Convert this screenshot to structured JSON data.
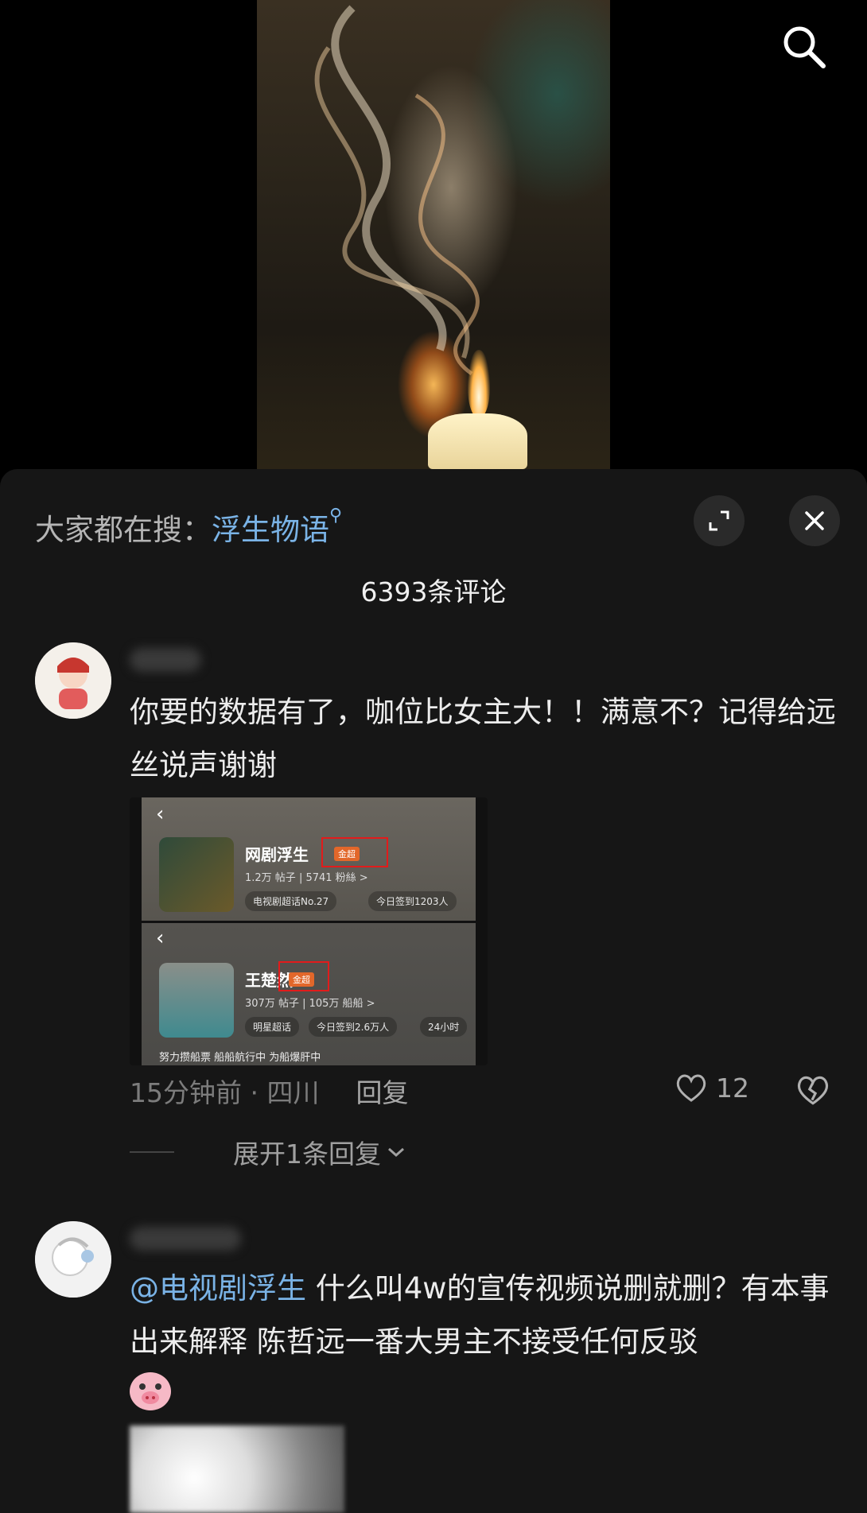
{
  "search_hint": {
    "prefix": "大家都在搜：",
    "keyword": "浮生物语"
  },
  "comment_count": "6393条评论",
  "comments": [
    {
      "text": "你要的数据有了，咖位比女主大！！满意不？记得给远丝说声谢谢",
      "time_location": "15分钟前 · 四川",
      "reply_label": "回复",
      "likes": "12",
      "expand_label": "展开1条回复",
      "image": {
        "panel1": {
          "title": "网剧浮生",
          "badge": "金超",
          "stats": "1.2万 帖子 | 5741 粉絲 >",
          "chip1": "电视剧超话No.27",
          "chip2": "今日签到1203人"
        },
        "panel2": {
          "title": "王楚然",
          "badge": "金超",
          "stats": "307万 帖子 | 105万 船船 >",
          "chip1": "明星超话",
          "chip2": "今日签到2.6万人",
          "chip3": "24小时",
          "row": "努力攒船票    船船航行中    为船爆肝中"
        }
      }
    },
    {
      "mention": "@电视剧浮生",
      "text": " 什么叫4w的宣传视频说删就删？有本事出来解释  陈哲远一番大男主不接受任何反驳"
    }
  ],
  "icons": [
    "search-icon",
    "expand-icon",
    "close-icon",
    "heart-icon",
    "broken-heart-icon",
    "chevron-down-icon",
    "pig-emoji"
  ],
  "colors": {
    "link": "#7ab3e6",
    "sheet_bg": "#161616",
    "highlight": "#e21b1b"
  }
}
